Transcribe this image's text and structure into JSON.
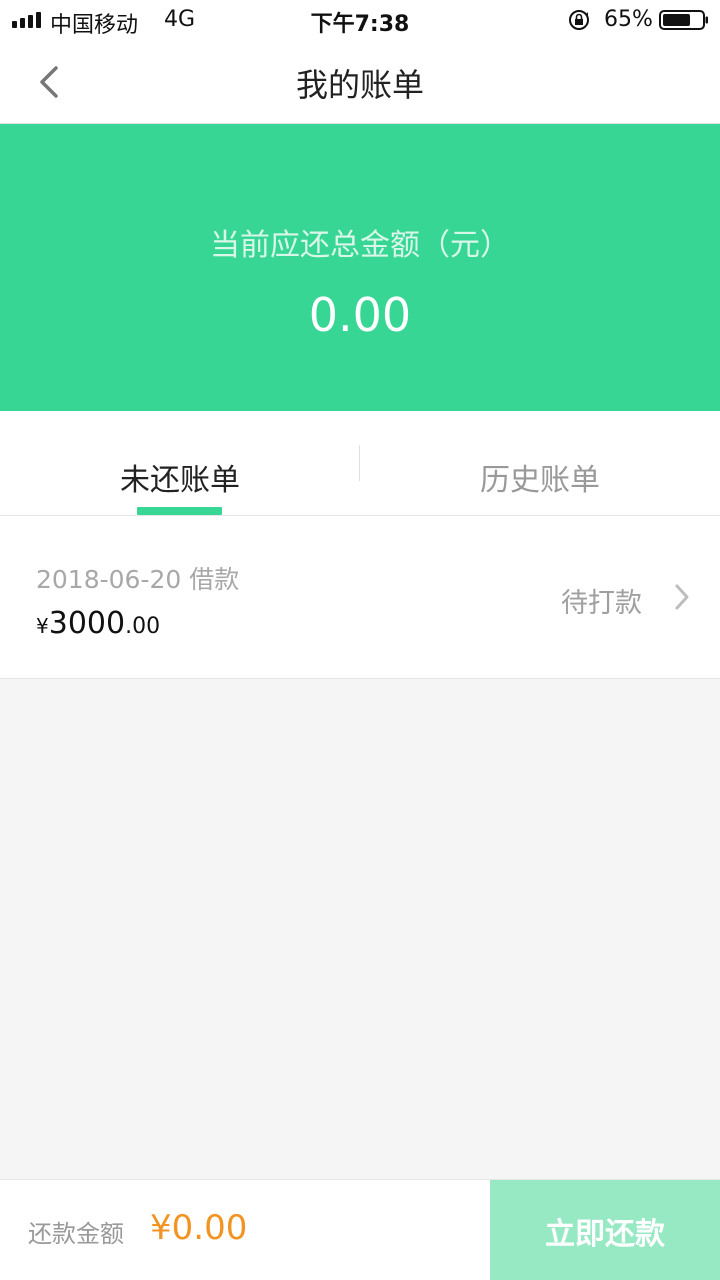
{
  "status_bar": {
    "carrier": "中国移动",
    "network": "4G",
    "time": "下午7:38",
    "battery": "65%",
    "icons": [
      "signal-icon",
      "rotation-lock-icon",
      "battery-icon"
    ]
  },
  "nav": {
    "title": "我的账单",
    "back_icon": "chevron-left-icon"
  },
  "summary": {
    "label": "当前应还总金额（元）",
    "amount": "0.00"
  },
  "tabs": [
    {
      "label": "未还账单",
      "active": true
    },
    {
      "label": "历史账单",
      "active": false
    }
  ],
  "bills": [
    {
      "date_label": "2018-06-20 借款",
      "currency": "¥",
      "amount_int": "3000",
      "amount_dec": ".00",
      "status": "待打款",
      "icon": "chevron-right-icon"
    }
  ],
  "bottom_bar": {
    "label": "还款金额",
    "amount": "¥0.00",
    "button": "立即还款"
  },
  "colors": {
    "brand_green": "#38d695",
    "button_disabled": "#97e9c4",
    "amount_orange": "#f29423"
  }
}
